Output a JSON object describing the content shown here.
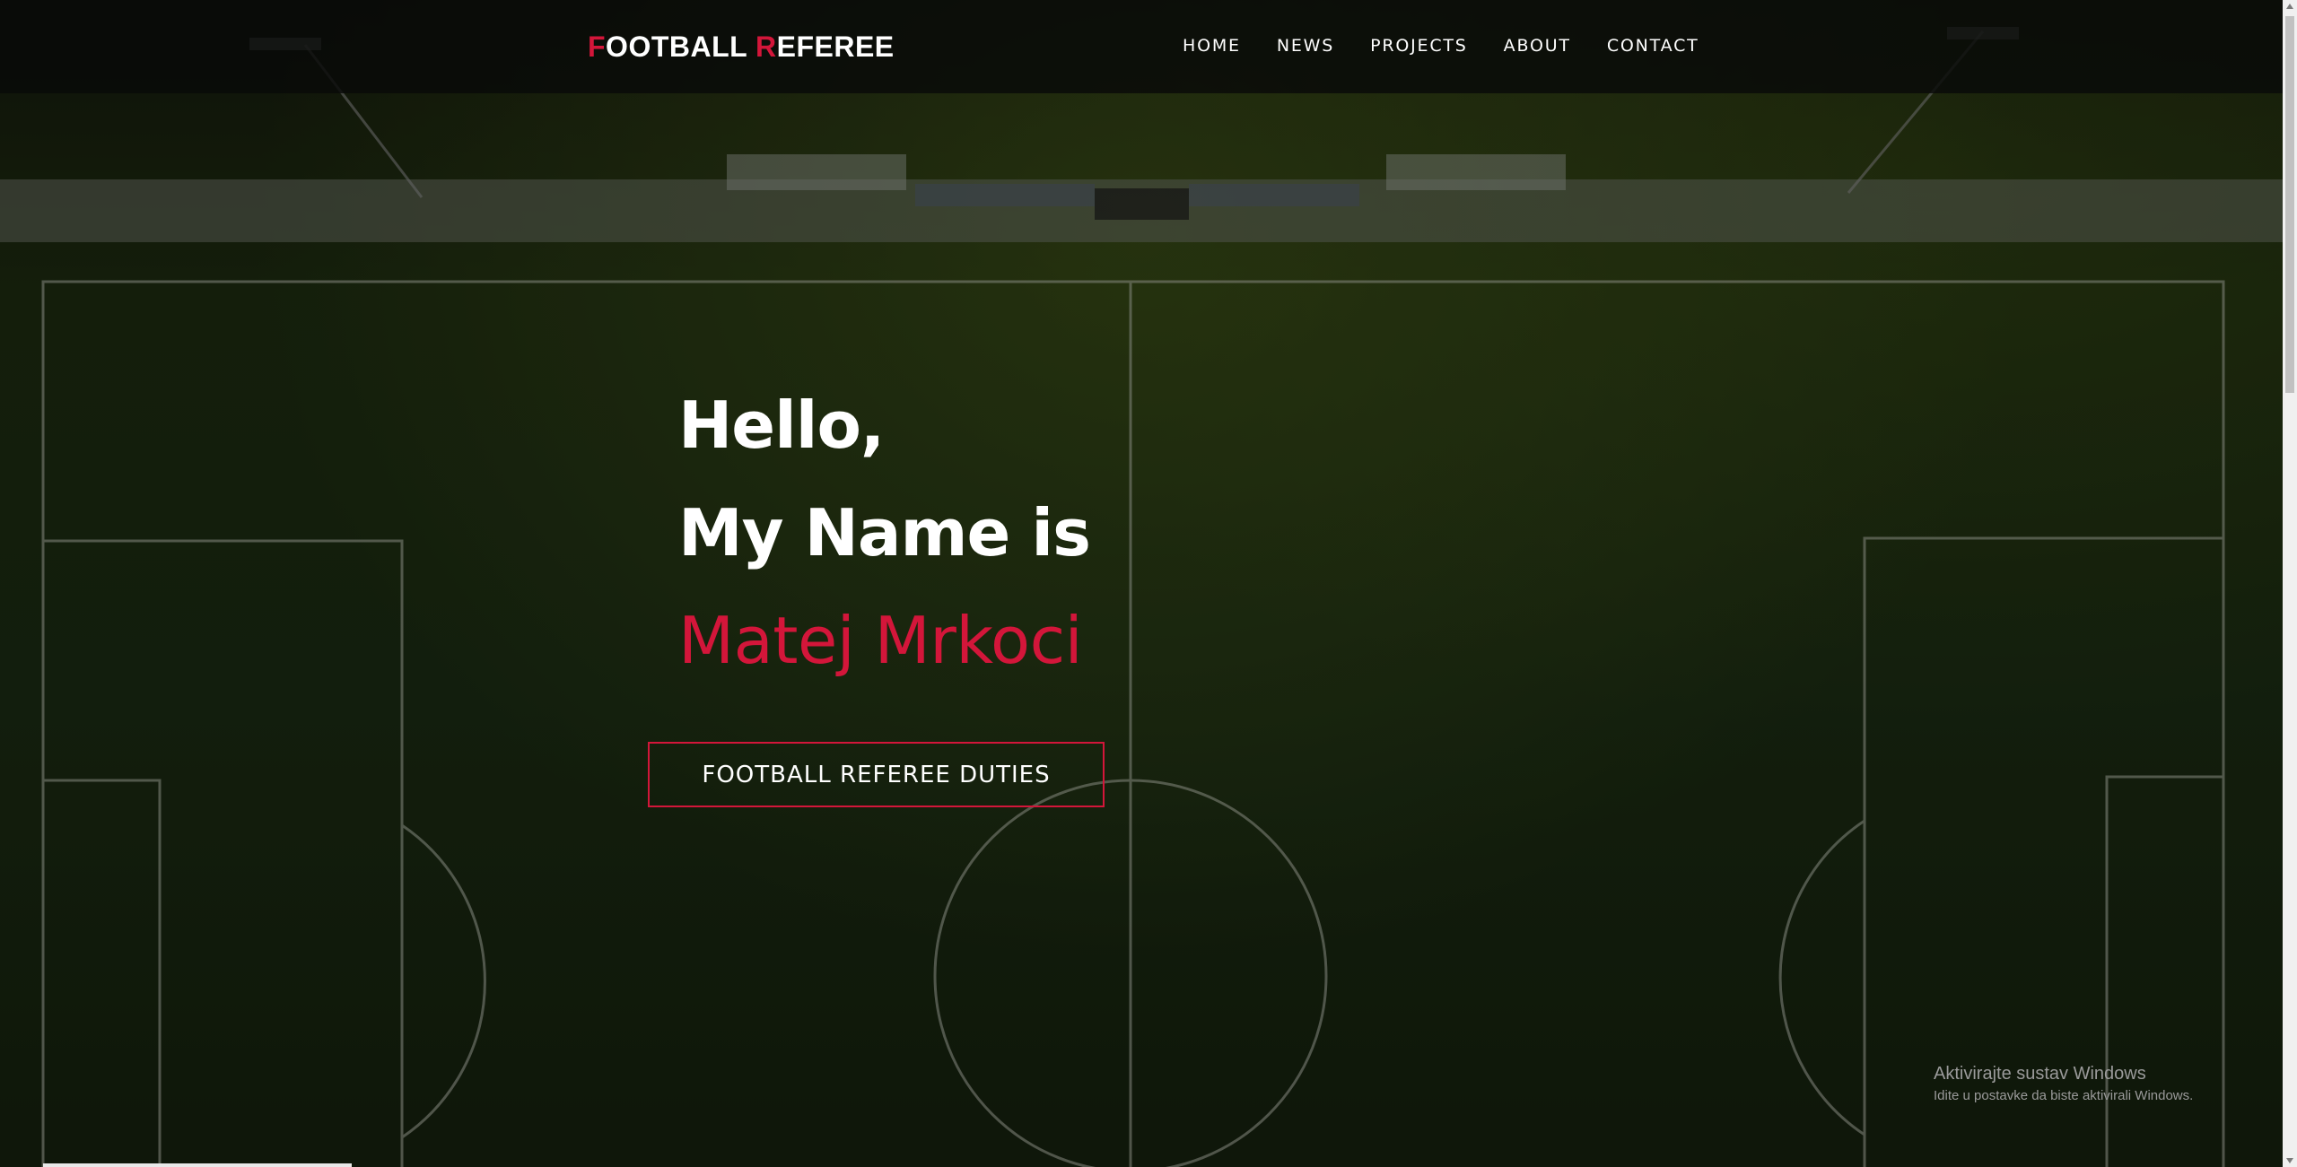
{
  "brand": {
    "first_initial": "F",
    "first_rest": "OOTBALL",
    "second_initial": "R",
    "second_rest": "EFEREE"
  },
  "nav": {
    "items": [
      "HOME",
      "NEWS",
      "PROJECTS",
      "ABOUT",
      "CONTACT"
    ]
  },
  "hero": {
    "line1": "Hello,",
    "line2": "My Name is",
    "name": "Matej Mrkoci",
    "cta_label": "FOOTBALL REFEREE DUTIES"
  },
  "windows_watermark": {
    "line1": "Aktivirajte sustav Windows",
    "line2": "Idite u postavke da biste aktivirali Windows."
  },
  "colors": {
    "accent": "#d3163a",
    "nav_bg": "#080a08",
    "text": "#ffffff"
  }
}
